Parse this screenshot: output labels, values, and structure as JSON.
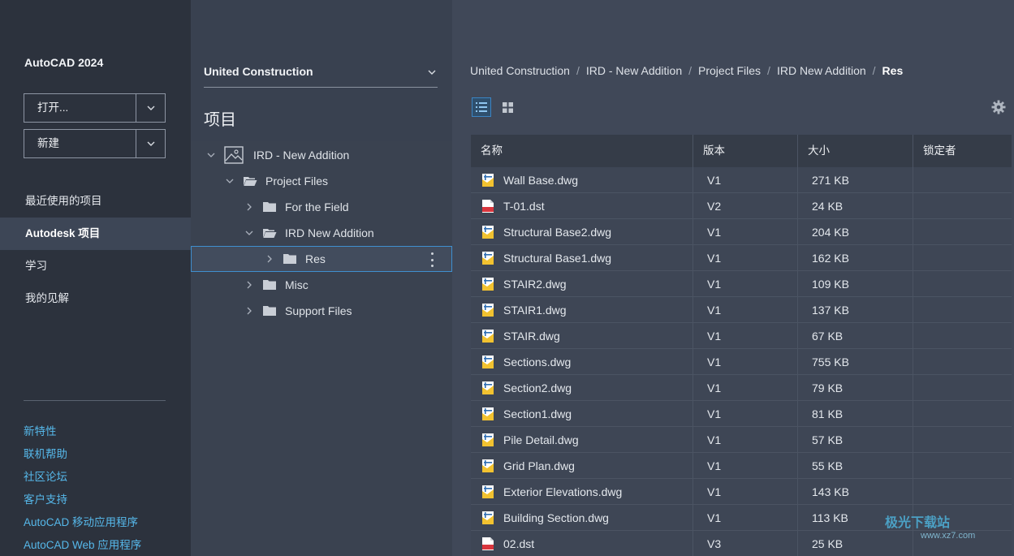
{
  "sidebar": {
    "app_title": "AutoCAD 2024",
    "open_button": "打开...",
    "new_button": "新建",
    "nav": {
      "recent": "最近使用的项目",
      "autodesk_projects": "Autodesk 项目",
      "learn": "学习",
      "insights": "我的见解"
    },
    "links": {
      "whats_new": "新特性",
      "online_help": "联机帮助",
      "community": "社区论坛",
      "support": "客户支持",
      "mobile_app": "AutoCAD 移动应用程序",
      "web_app": "AutoCAD Web 应用程序"
    }
  },
  "tree": {
    "hub": "United Construction",
    "heading": "项目",
    "items": [
      {
        "label": "IRD - New Addition"
      },
      {
        "label": "Project Files"
      },
      {
        "label": "For the Field"
      },
      {
        "label": "IRD New Addition"
      },
      {
        "label": "Res"
      },
      {
        "label": "Misc"
      },
      {
        "label": "Support Files"
      }
    ]
  },
  "breadcrumb": [
    "United Construction",
    "IRD - New Addition",
    "Project Files",
    "IRD New Addition",
    "Res"
  ],
  "table": {
    "headers": {
      "name": "名称",
      "version": "版本",
      "size": "大小",
      "locked_by": "锁定者"
    },
    "rows": [
      {
        "name": "Wall Base.dwg",
        "version": "V1",
        "size": "271 KB",
        "type": "dwg"
      },
      {
        "name": "T-01.dst",
        "version": "V2",
        "size": "24 KB",
        "type": "dst"
      },
      {
        "name": "Structural Base2.dwg",
        "version": "V1",
        "size": "204 KB",
        "type": "dwg"
      },
      {
        "name": "Structural Base1.dwg",
        "version": "V1",
        "size": "162 KB",
        "type": "dwg"
      },
      {
        "name": "STAIR2.dwg",
        "version": "V1",
        "size": "109 KB",
        "type": "dwg"
      },
      {
        "name": "STAIR1.dwg",
        "version": "V1",
        "size": "137 KB",
        "type": "dwg"
      },
      {
        "name": "STAIR.dwg",
        "version": "V1",
        "size": "67 KB",
        "type": "dwg"
      },
      {
        "name": "Sections.dwg",
        "version": "V1",
        "size": "755 KB",
        "type": "dwg"
      },
      {
        "name": "Section2.dwg",
        "version": "V1",
        "size": "79 KB",
        "type": "dwg"
      },
      {
        "name": "Section1.dwg",
        "version": "V1",
        "size": "81 KB",
        "type": "dwg"
      },
      {
        "name": "Pile Detail.dwg",
        "version": "V1",
        "size": "57 KB",
        "type": "dwg"
      },
      {
        "name": "Grid Plan.dwg",
        "version": "V1",
        "size": "55 KB",
        "type": "dwg"
      },
      {
        "name": "Exterior Elevations.dwg",
        "version": "V1",
        "size": "143 KB",
        "type": "dwg"
      },
      {
        "name": "Building Section.dwg",
        "version": "V1",
        "size": "113 KB",
        "type": "dwg"
      },
      {
        "name": "02.dst",
        "version": "V3",
        "size": "25 KB",
        "type": "dst"
      }
    ]
  },
  "watermark": {
    "text": "极光下载站",
    "url": "www.xz7.com"
  },
  "colors": {
    "accent": "#3b85c4",
    "link": "#56b8ea",
    "dwg_icon": "#f2c230",
    "dst_icon": "#d9363e"
  }
}
